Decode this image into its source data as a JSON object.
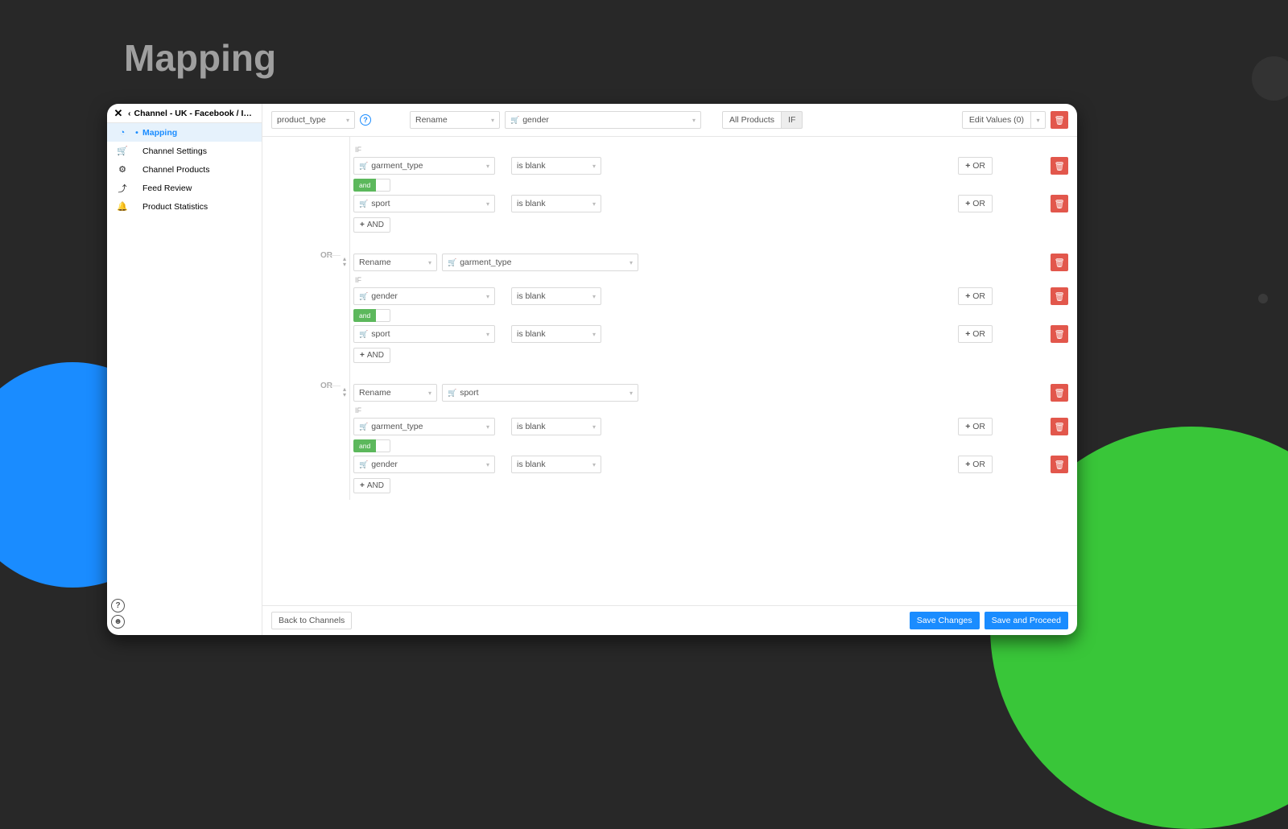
{
  "page_heading": "Mapping",
  "sidebar": {
    "channel_title": "Channel - UK - Facebook / I…",
    "items": [
      {
        "label": "Mapping",
        "icon": "◔",
        "active": true
      },
      {
        "label": "Channel Settings",
        "icon": "🛒",
        "active": false
      },
      {
        "label": "Channel Products",
        "icon": "⚙",
        "active": false
      },
      {
        "label": "Feed Review",
        "icon": "⤴",
        "active": false
      },
      {
        "label": "Product Statistics",
        "icon": "🔔",
        "active": false
      }
    ]
  },
  "toolbar": {
    "attribute": "product_type",
    "action": "Rename",
    "field": "gender",
    "all_products": "All Products",
    "if": "IF",
    "edit_values": "Edit Values (0)"
  },
  "rules": [
    {
      "action": "Rename",
      "field": "garment_type",
      "or_label": "OR",
      "conditions": [
        {
          "field": "gender",
          "op": "is blank"
        },
        {
          "field": "sport",
          "op": "is blank"
        }
      ]
    },
    {
      "action": "Rename",
      "field": "sport",
      "or_label": "OR",
      "conditions": [
        {
          "field": "garment_type",
          "op": "is blank"
        },
        {
          "field": "gender",
          "op": "is blank"
        }
      ]
    }
  ],
  "first_rule": {
    "conditions": [
      {
        "field": "garment_type",
        "op": "is blank"
      },
      {
        "field": "sport",
        "op": "is blank"
      }
    ]
  },
  "labels": {
    "if": "IF",
    "and": "and",
    "plus_and": "AND",
    "plus_or": "OR",
    "back": "Back to Channels",
    "save": "Save Changes",
    "proceed": "Save and Proceed"
  }
}
